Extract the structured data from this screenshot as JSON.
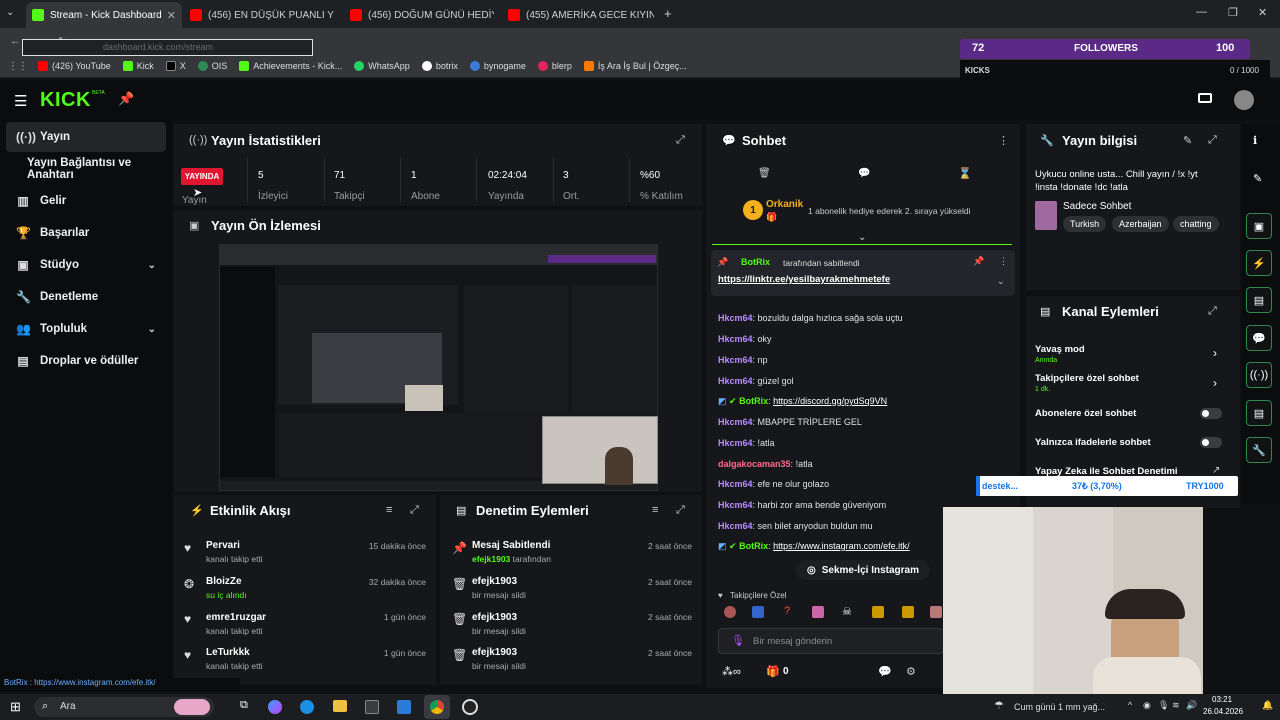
{
  "browser": {
    "tabs": [
      {
        "label": "Stream - Kick Dashboard",
        "active": true
      },
      {
        "label": "(456) EN DÜŞÜK PUANLI YURT"
      },
      {
        "label": "(456) DOĞUM GÜNÜ HEDİYELE"
      },
      {
        "label": "(455) AMERİKA GECE KIYINTISI"
      }
    ],
    "url": "dashboard.kick.com/stream",
    "bookmarks": [
      "(426) YouTube",
      "Kick",
      "X",
      "OIS",
      "Achievements - Kick...",
      "WhatsApp",
      "botrix",
      "bynogame",
      "blerp",
      "İş Ara İş Bul | Özgeç..."
    ]
  },
  "overlay": {
    "followers_count": "72",
    "followers_label": "FOLLOWERS",
    "followers_goal": "100",
    "kicks_label": "KICKS",
    "kicks_value": "0 / 1000",
    "donation_label": "destek...",
    "donation_progress": "37₺ (3,70%)",
    "donation_goal": "TRY1000",
    "bottom_ticker": "BotRix : https://www.instagram.com/efe.itk/"
  },
  "header": {
    "logo": "KICK",
    "beta": "BETA"
  },
  "sidebar": {
    "items": [
      {
        "label": "Yayın",
        "icon": "broadcast-icon",
        "active": true
      },
      {
        "label": "Yayın Bağlantısı ve Anahtarı"
      },
      {
        "label": "Gelir",
        "icon": "chart-icon"
      },
      {
        "label": "Başarılar",
        "icon": "trophy-icon"
      },
      {
        "label": "Stüdyo",
        "icon": "studio-icon",
        "expandable": true
      },
      {
        "label": "Denetleme",
        "icon": "wrench-icon"
      },
      {
        "label": "Topluluk",
        "icon": "community-icon",
        "expandable": true
      },
      {
        "label": "Droplar ve ödüller",
        "icon": "drops-icon"
      }
    ]
  },
  "stats": {
    "title": "Yayın İstatistikleri",
    "live_badge": "YAYINDA",
    "live_label": "Yayın",
    "items": [
      {
        "value": "5",
        "label": "İzleyici"
      },
      {
        "value": "71",
        "label": "Takipçi"
      },
      {
        "value": "1",
        "label": "Abone"
      },
      {
        "value": "02:24:04",
        "label": "Yayında"
      },
      {
        "value": "3",
        "label": "Ort."
      },
      {
        "value": "%60",
        "label": "% Katılım"
      }
    ]
  },
  "preview": {
    "title": "Yayın Ön İzlemesi"
  },
  "activity": {
    "title": "Etkinlik Akışı",
    "items": [
      {
        "name": "Pervari",
        "sub": "kanalı takip etti",
        "time": "15 dakika önce"
      },
      {
        "name": "BloizZe",
        "sub": "su iç alındı",
        "time": "32 dakika önce"
      },
      {
        "name": "emre1ruzgar",
        "sub": "kanalı takip etti",
        "time": "1 gün önce"
      },
      {
        "name": "LeTurkkk",
        "sub": "kanalı takip etti",
        "time": "1 gün önce"
      }
    ]
  },
  "moderation": {
    "title": "Denetim Eylemleri",
    "items": [
      {
        "name": "Mesaj Sabitlendi",
        "sub_user": "efejk1903",
        "sub": "tarafından",
        "time": "2 saat önce"
      },
      {
        "name": "efejk1903",
        "sub": "bir mesajı sildi",
        "time": "2 saat önce"
      },
      {
        "name": "efejk1903",
        "sub": "bir mesajı sildi",
        "time": "2 saat önce"
      },
      {
        "name": "efejk1903",
        "sub": "bir mesajı sildi",
        "time": "2 saat önce"
      }
    ]
  },
  "chat": {
    "title": "Sohbet",
    "gift_user": "Orkanik",
    "gift_count": "1",
    "gift_text": "1 abonelik hediye ederek 2. sıraya yükseldi",
    "pinned_by": "BotRix",
    "pinned_suffix": "tarafından sabitlendi",
    "pinned_link": "https://linktr.ee/yesilbayrakmehmetefe",
    "messages": [
      {
        "user": "Hkcm64",
        "text": "bozuldu dalga hızlıca sağa sola uçtu",
        "type": "u"
      },
      {
        "user": "Hkcm64",
        "text": "oky",
        "type": "u"
      },
      {
        "user": "Hkcm64",
        "text": "np",
        "type": "u"
      },
      {
        "user": "Hkcm64",
        "text": "güzel gol",
        "type": "u"
      },
      {
        "user": "BotRix",
        "text": "https://discord.gg/pydSq9VN",
        "type": "b",
        "link": true
      },
      {
        "user": "Hkcm64",
        "text": "MBAPPE TRİPLERE GEL",
        "type": "u"
      },
      {
        "user": "Hkcm64",
        "text": "!atla",
        "type": "u"
      },
      {
        "user": "dalgakocaman35",
        "text": "!atla",
        "type": "r"
      },
      {
        "user": "Hkcm64",
        "text": "efe ne olur golazo",
        "type": "u"
      },
      {
        "user": "Hkcm64",
        "text": "harbi zor ama bende güveniyom",
        "type": "u"
      },
      {
        "user": "Hkcm64",
        "text": "sen bilet anyodun buldun mu",
        "type": "u"
      },
      {
        "user": "BotRix",
        "text": "https://www.instagram.com/efe.itk/",
        "type": "b",
        "link": true
      }
    ],
    "instagram_button": "Sekme-İçi Instagram",
    "followers_only": "Takipçilere Özel",
    "input_placeholder": "Bir mesaj gönderin",
    "points": "0"
  },
  "stream_info": {
    "title": "Yayın bilgisi",
    "stream_title": "Uykucu online usta... Chill yayın / !x !yt !insta !donate !dc !atla",
    "category": "Sadece Sohbet",
    "tags": [
      "Turkish",
      "Azerbaijan",
      "chatting"
    ]
  },
  "channel_actions": {
    "title": "Kanal Eylemleri",
    "items": [
      {
        "label": "Yavaş mod",
        "sub": "Anında",
        "control": "chevron"
      },
      {
        "label": "Takipçilere özel sohbet",
        "sub": "1 dk.",
        "control": "chevron"
      },
      {
        "label": "Abonelere özel sohbet",
        "control": "toggle"
      },
      {
        "label": "Yalnızca ifadelerle sohbet",
        "control": "toggle"
      },
      {
        "label": "Yapay Zeka ile Sohbet Denetimi",
        "control": "external"
      }
    ]
  },
  "taskbar": {
    "search": "Ara",
    "weather": "Cum günü 1 mm yağ...",
    "time": "03:21",
    "date": "26.04.2026"
  }
}
